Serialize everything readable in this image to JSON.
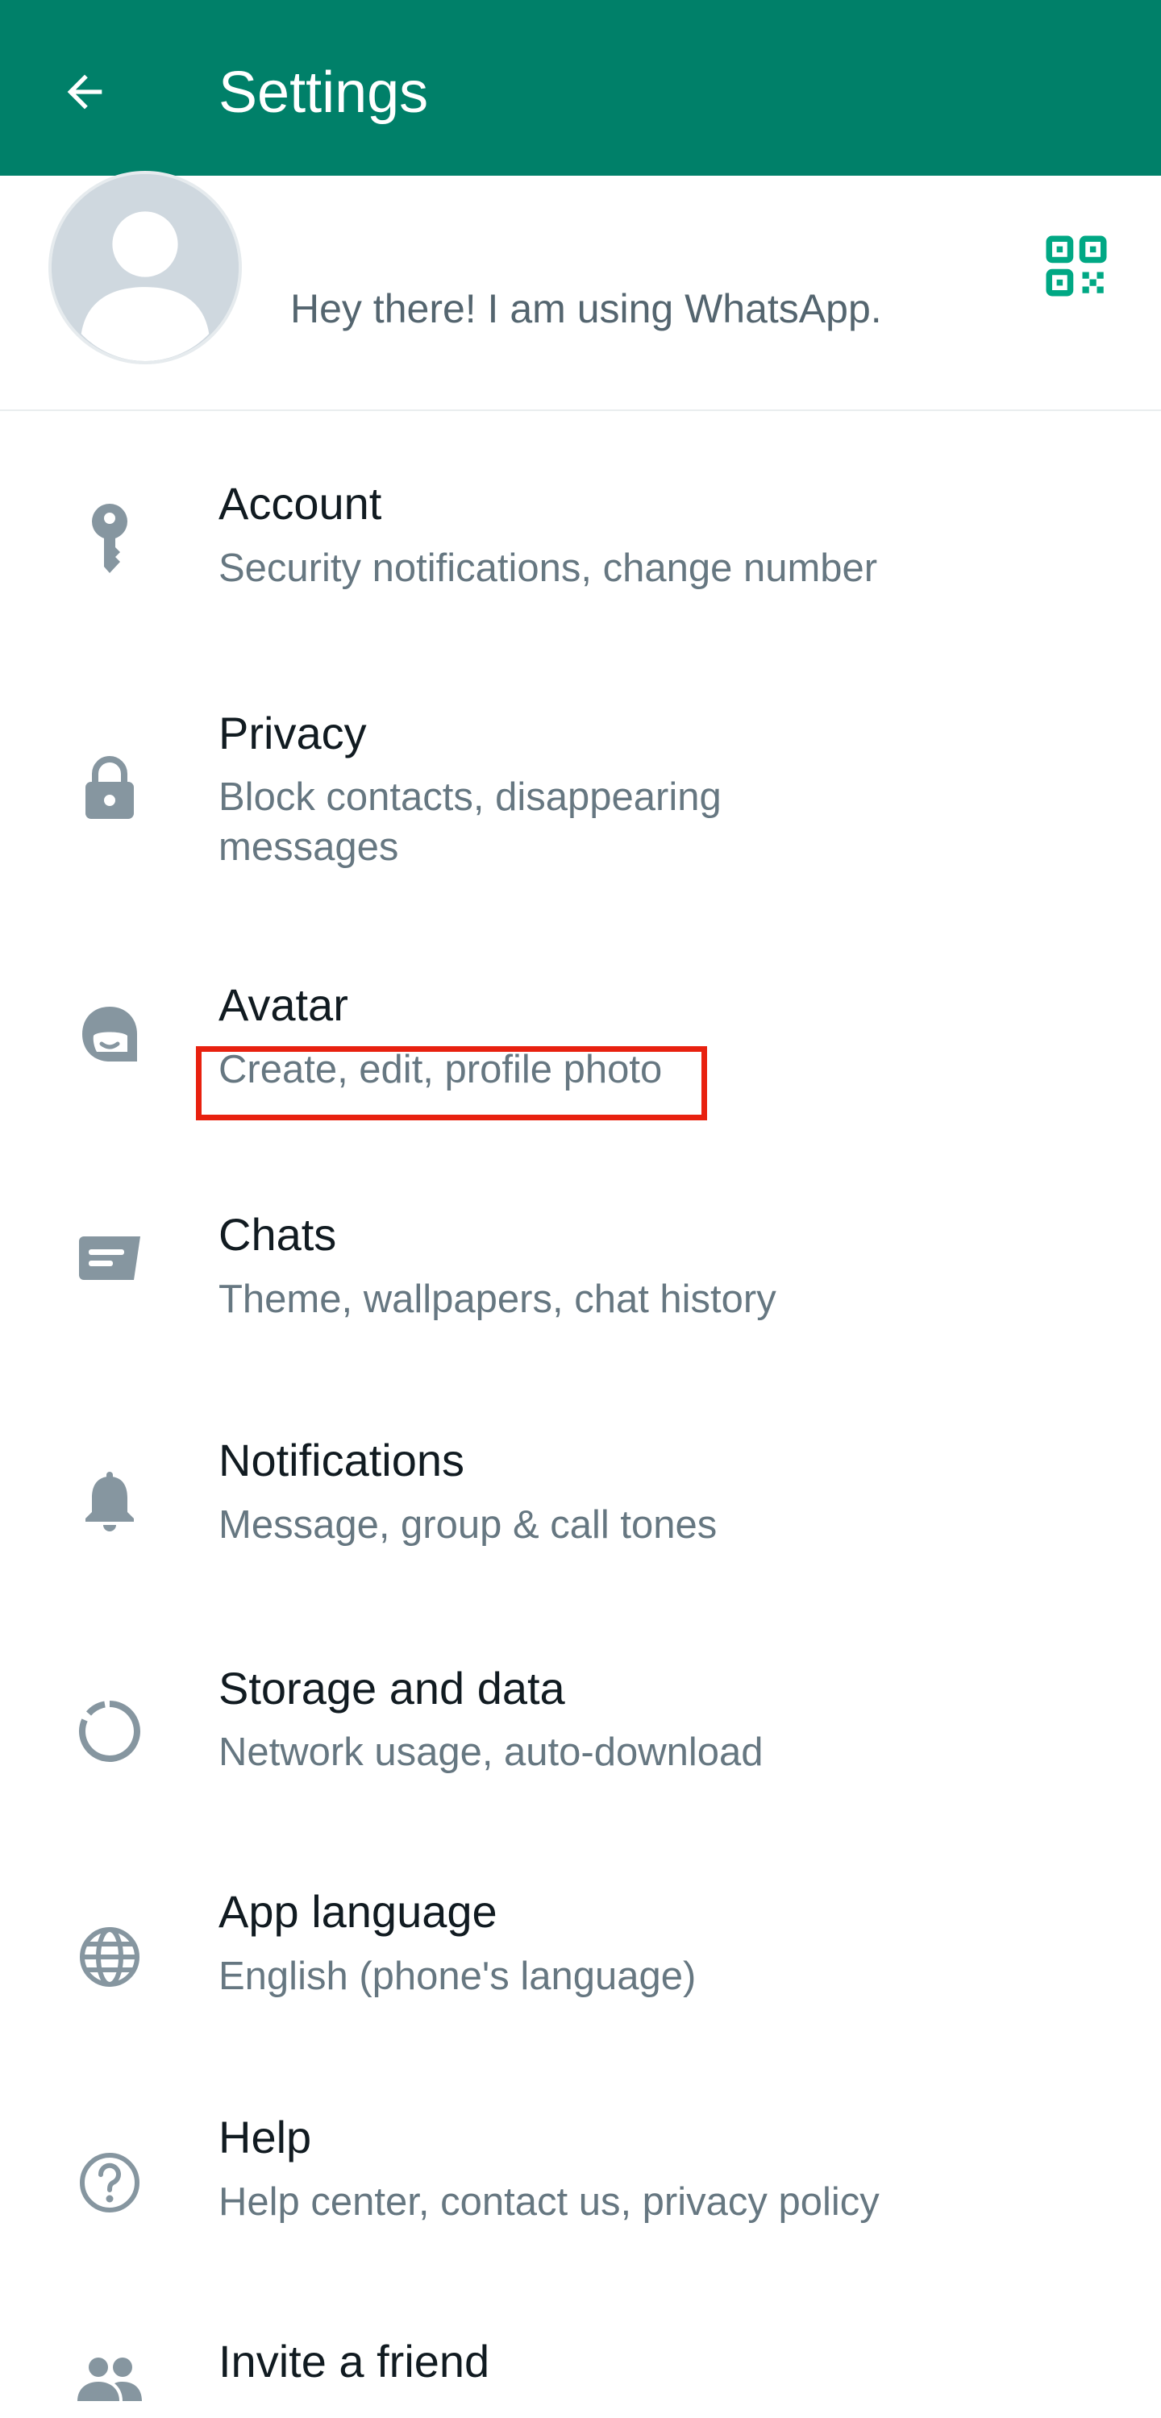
{
  "appbar": {
    "title": "Settings",
    "back_icon": "arrow-left-icon"
  },
  "profile": {
    "status": "Hey there! I am using WhatsApp.",
    "qr_icon": "qr-code-icon"
  },
  "settings": [
    {
      "title": "Account",
      "subtitle": "Security notifications, change number",
      "icon": "key-icon"
    },
    {
      "title": "Privacy",
      "subtitle": "Block contacts, disappearing",
      "subtitle2": "messages",
      "icon": "lock-icon"
    },
    {
      "title": "Avatar",
      "subtitle": "Create, edit, profile photo",
      "icon": "avatar-face-icon"
    },
    {
      "title": "Chats",
      "subtitle": "Theme, wallpapers, chat history",
      "icon": "chat-icon"
    },
    {
      "title": "Notifications",
      "subtitle": "Message, group & call tones",
      "icon": "bell-icon"
    },
    {
      "title": "Storage and data",
      "subtitle": "Network usage, auto-download",
      "icon": "storage-circle-icon"
    },
    {
      "title": "App language",
      "subtitle": "English (phone's language)",
      "icon": "globe-icon"
    },
    {
      "title": "Help",
      "subtitle": "Help center, contact us, privacy policy",
      "icon": "help-icon"
    },
    {
      "title": "Invite a friend",
      "icon": "people-icon"
    }
  ],
  "colors": {
    "appbar": "#008069",
    "icon_gray": "#8696a0",
    "qr_green": "#00a884",
    "highlight": "#e8210f"
  }
}
